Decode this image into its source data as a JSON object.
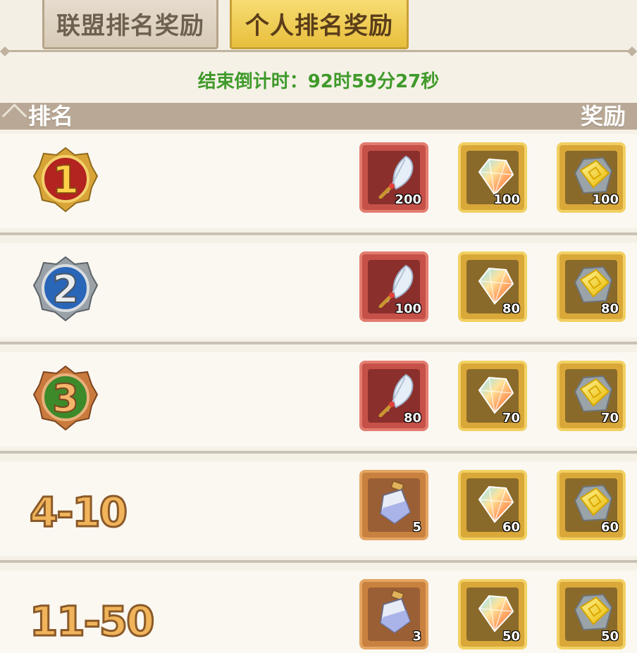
{
  "tabs": {
    "alliance": "联盟排名奖励",
    "personal": "个人排名奖励"
  },
  "countdown": "结束倒计时：92时59分27秒",
  "header": {
    "rank": "排名",
    "reward": "奖励"
  },
  "rows": [
    {
      "rank_label": "1",
      "rewards": [
        {
          "icon": "feather-quill-icon",
          "qty": "200"
        },
        {
          "icon": "rainbow-gem-icon",
          "qty": "100"
        },
        {
          "icon": "gold-ore-icon",
          "qty": "100"
        }
      ]
    },
    {
      "rank_label": "2",
      "rewards": [
        {
          "icon": "feather-quill-icon",
          "qty": "100"
        },
        {
          "icon": "rainbow-gem-icon",
          "qty": "80"
        },
        {
          "icon": "gold-ore-icon",
          "qty": "80"
        }
      ]
    },
    {
      "rank_label": "3",
      "rewards": [
        {
          "icon": "feather-quill-icon",
          "qty": "80"
        },
        {
          "icon": "rainbow-gem-icon",
          "qty": "70"
        },
        {
          "icon": "gold-ore-icon",
          "qty": "70"
        }
      ]
    },
    {
      "rank_label": "4-10",
      "rewards": [
        {
          "icon": "potion-bottle-icon",
          "qty": "5"
        },
        {
          "icon": "rainbow-gem-icon",
          "qty": "60"
        },
        {
          "icon": "gold-ore-icon",
          "qty": "60"
        }
      ]
    },
    {
      "rank_label": "11-50",
      "rewards": [
        {
          "icon": "potion-bottle-icon",
          "qty": "3"
        },
        {
          "icon": "rainbow-gem-icon",
          "qty": "50"
        },
        {
          "icon": "gold-ore-icon",
          "qty": "50"
        }
      ]
    }
  ]
}
